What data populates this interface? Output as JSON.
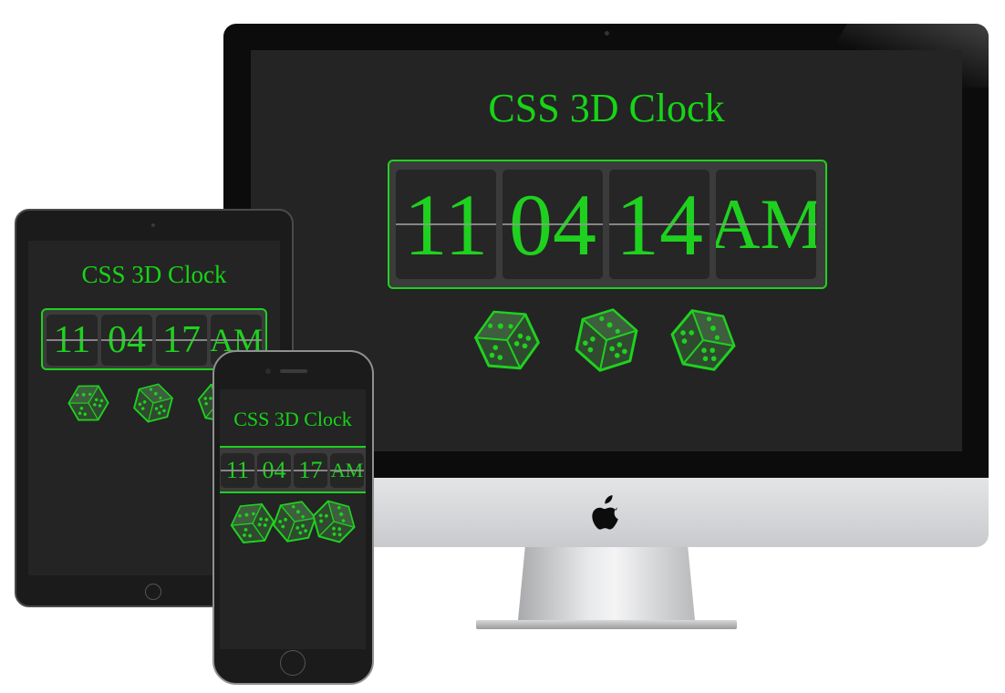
{
  "colors": {
    "accent_green": "#1fd11f",
    "screen_bg": "#242424",
    "tile_bg": "#262626",
    "clock_frame_bg": "#3b3b3b"
  },
  "imac": {
    "title": "CSS 3D Clock",
    "clock": {
      "hours": "11",
      "minutes": "04",
      "seconds": "14",
      "meridiem": "AM"
    },
    "dice_count": 3
  },
  "ipad": {
    "title": "CSS 3D Clock",
    "clock": {
      "hours": "11",
      "minutes": "04",
      "seconds": "17",
      "meridiem": "AM"
    }
  },
  "iphone": {
    "title": "CSS 3D Clock",
    "clock": {
      "hours": "11",
      "minutes": "04",
      "seconds": "17",
      "meridiem": "AM"
    }
  },
  "icons": [
    "apple-logo-icon",
    "dice-icon"
  ]
}
